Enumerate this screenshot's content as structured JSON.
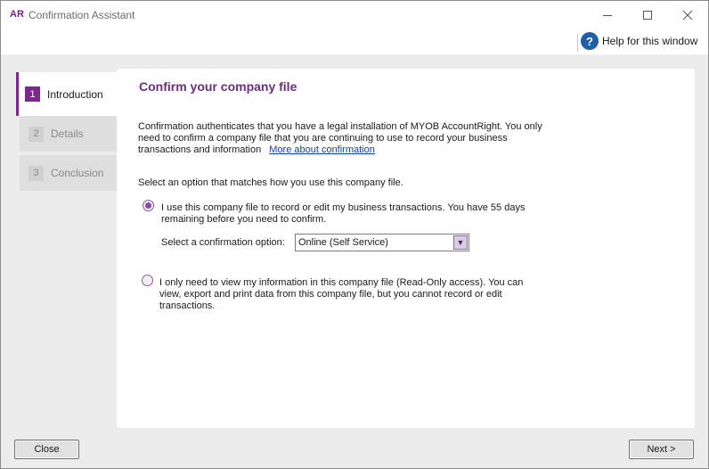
{
  "window": {
    "logo": "AR",
    "title": "Confirmation Assistant",
    "controls": {
      "minimize": "minimize-icon",
      "maximize": "maximize-icon",
      "close": "close-icon"
    }
  },
  "help": {
    "label": "Help for this window",
    "icon": "help-icon"
  },
  "steps": [
    {
      "number": "1",
      "label": "Introduction",
      "state": "active"
    },
    {
      "number": "2",
      "label": "Details",
      "state": "inactive"
    },
    {
      "number": "3",
      "label": "Conclusion",
      "state": "inactive"
    }
  ],
  "content": {
    "title": "Confirm your company file",
    "intro_text": "Confirmation authenticates that you have a legal installation of MYOB AccountRight.  You only need to confirm a company file that you are continuing to use to record your business transactions and information",
    "intro_link": "More about confirmation",
    "select_prompt": "Select an option that matches how you use this company file.",
    "option1": {
      "text": "I use this company file to record or edit my business transactions.  You have 55 days remaining before you need to confirm.",
      "selected": true,
      "conf_label": "Select a confirmation option:",
      "conf_value": "Online (Self Service)"
    },
    "option2": {
      "text": "I only need to view my information in this company file (Read-Only access). You can view, export and print data from this company file, but you cannot record or edit transactions.",
      "selected": false
    }
  },
  "buttons": {
    "close": "Close",
    "next": "Next >"
  },
  "colors": {
    "accent": "#7a2a8e",
    "title": "#6b2d7e",
    "link": "#0a3ad6",
    "help_icon": "#1f5fa7"
  }
}
